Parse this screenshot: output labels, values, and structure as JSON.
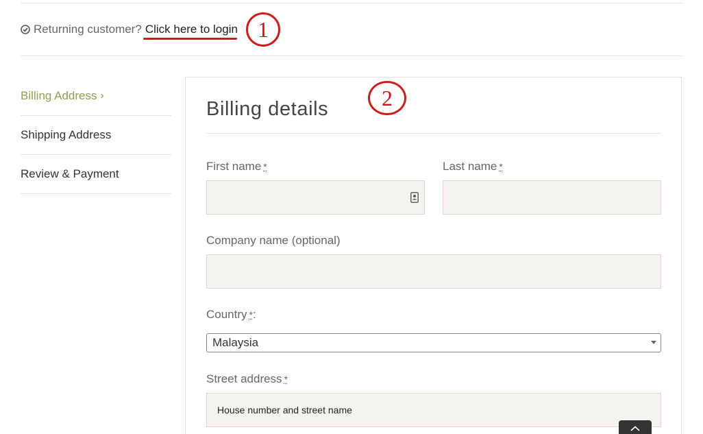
{
  "notice": {
    "text": "Returning customer?",
    "link_label": "Click here to login",
    "check_icon": "check-circle-icon"
  },
  "annotations": {
    "first": "1",
    "second": "2"
  },
  "steps": [
    {
      "label": "Billing Address",
      "active": true,
      "chevron": "›"
    },
    {
      "label": "Shipping Address",
      "active": false
    },
    {
      "label": "Review & Payment",
      "active": false
    }
  ],
  "billing": {
    "title": "Billing details",
    "first_name_label": "First name",
    "last_name_label": "Last name",
    "company_label": "Company name (optional)",
    "country_label": "Country",
    "country_label_suffix": ":",
    "country_value": "Malaysia",
    "street_label": "Street address",
    "street_placeholder": "House number and street name",
    "required_mark": "*"
  },
  "colors": {
    "accent_active": "#8ea050",
    "annotation_red": "#d11b1b",
    "field_bg": "#f5f3ef"
  }
}
